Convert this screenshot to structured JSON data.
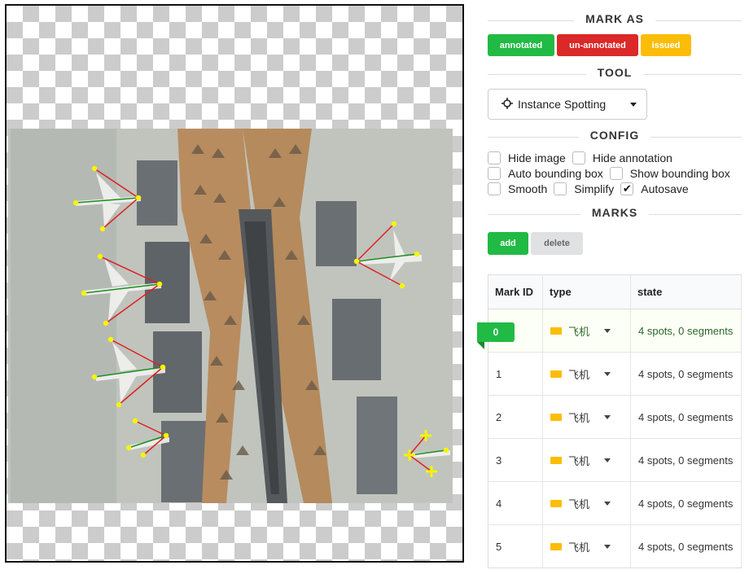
{
  "mark_as": {
    "title": "MARK AS",
    "annotated": "annotated",
    "unannotated": "un-annotated",
    "issued": "issued"
  },
  "tool": {
    "title": "TOOL",
    "selected": "Instance Spotting",
    "icon": "crosshair-icon"
  },
  "config": {
    "title": "CONFIG",
    "options": [
      {
        "label": "Hide image",
        "checked": false
      },
      {
        "label": "Hide annotation",
        "checked": false
      },
      {
        "label": "Auto bounding box",
        "checked": false
      },
      {
        "label": "Show bounding box",
        "checked": false
      },
      {
        "label": "Smooth",
        "checked": false
      },
      {
        "label": "Simplify",
        "checked": false
      },
      {
        "label": "Autosave",
        "checked": true
      }
    ]
  },
  "marks": {
    "title": "MARKS",
    "add_label": "add",
    "delete_label": "delete",
    "headers": [
      "Mark ID",
      "type",
      "state"
    ],
    "rows": [
      {
        "id": "0",
        "type": "飞机",
        "state": "4 spots, 0 segments"
      },
      {
        "id": "1",
        "type": "飞机",
        "state": "4 spots, 0 segments"
      },
      {
        "id": "2",
        "type": "飞机",
        "state": "4 spots, 0 segments"
      },
      {
        "id": "3",
        "type": "飞机",
        "state": "4 spots, 0 segments"
      },
      {
        "id": "4",
        "type": "飞机",
        "state": "4 spots, 0 segments"
      },
      {
        "id": "5",
        "type": "飞机",
        "state": "4 spots, 0 segments"
      }
    ]
  },
  "colors": {
    "annotated": "#21ba45",
    "unannotated": "#db2828",
    "issued": "#fbbd08",
    "type_swatch": "#fbbd08",
    "spot": "#f5f500",
    "segment_green": "#1a8f1a",
    "segment_red": "#e02020"
  }
}
